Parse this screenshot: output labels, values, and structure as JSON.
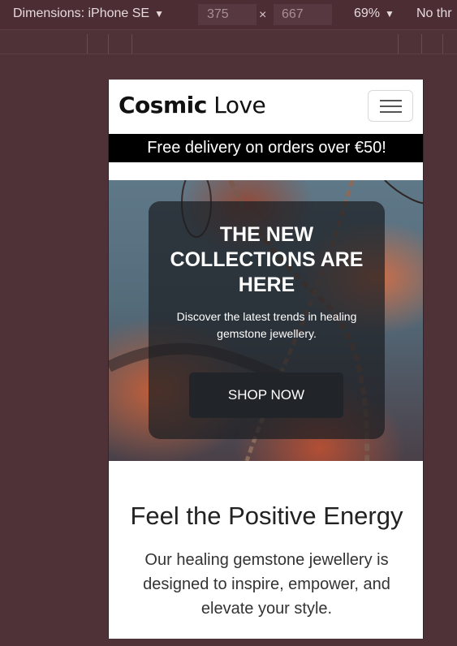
{
  "devtools": {
    "dimensions_label": "Dimensions: iPhone SE",
    "width_value": "375",
    "times_symbol": "×",
    "height_value": "667",
    "zoom_label": "69%",
    "throttle_label": "No thr",
    "caret": "▼"
  },
  "site": {
    "brand": {
      "bold": "Cosmic",
      "light": " Love"
    },
    "menu_button_icon": "hamburger-icon",
    "promo": "Free delivery on orders over €50!",
    "hero": {
      "title": "THE NEW COLLECTIONS ARE HERE",
      "text": "Discover the latest trends in healing gemstone jewellery.",
      "button": "SHOP NOW"
    },
    "section": {
      "title": "Feel the Positive Energy",
      "text": "Our healing gemstone jewellery is designed to inspire, empower, and elevate your style."
    }
  },
  "colors": {
    "devtools_background": "#4f3138",
    "promo_background": "#000000",
    "button_background": "#212529"
  }
}
